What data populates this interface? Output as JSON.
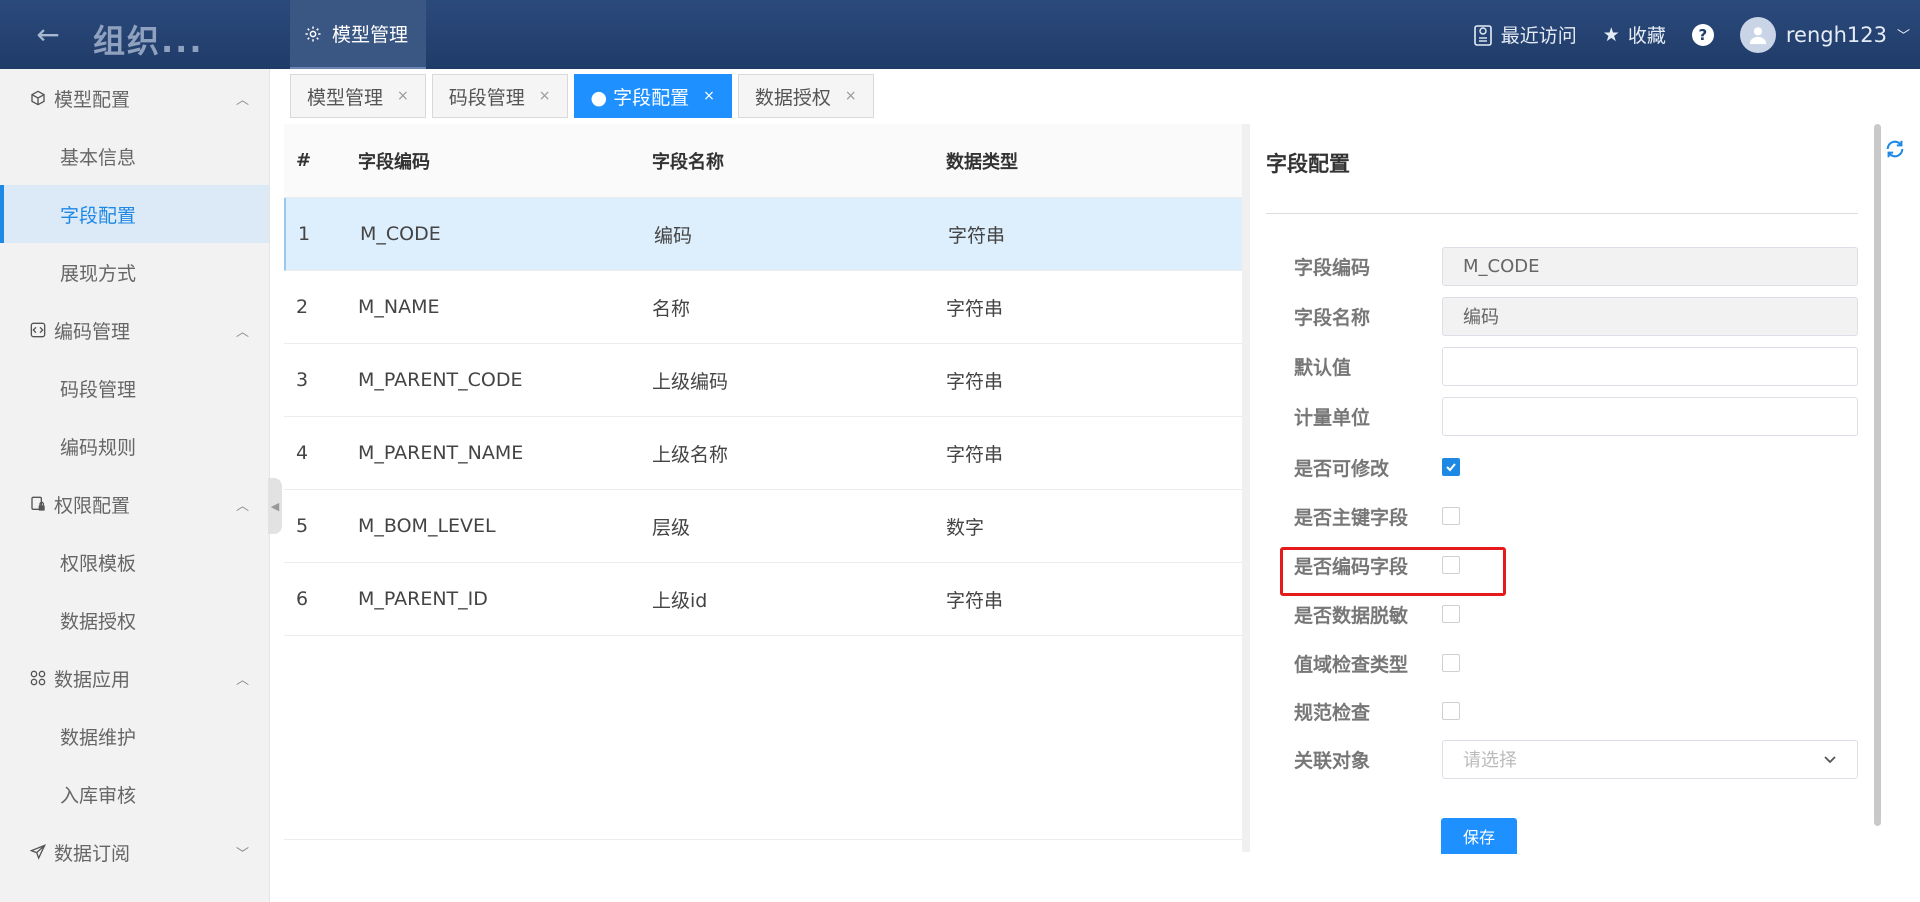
{
  "topbar": {
    "app_title": "组织...",
    "active_tab": "模型管理",
    "recent_visit": "最近访问",
    "favorites": "收藏",
    "help": "?",
    "username": "rengh123"
  },
  "sidebar": {
    "groups": [
      {
        "label": "模型配置",
        "icon": "cube-icon",
        "items": [
          "基本信息",
          "字段配置",
          "展现方式"
        ]
      },
      {
        "label": "编码管理",
        "icon": "code-icon",
        "items": [
          "码段管理",
          "编码规则"
        ]
      },
      {
        "label": "权限配置",
        "icon": "lock-doc-icon",
        "items": [
          "权限模板",
          "数据授权"
        ]
      },
      {
        "label": "数据应用",
        "icon": "grid-icon",
        "items": [
          "数据维护",
          "入库审核"
        ]
      },
      {
        "label": "数据订阅",
        "icon": "send-icon",
        "items": []
      }
    ],
    "active_item": "字段配置"
  },
  "tabs": [
    {
      "label": "模型管理",
      "close": "×"
    },
    {
      "label": "码段管理",
      "close": "×"
    },
    {
      "label": "● 字段配置",
      "close": "×"
    },
    {
      "label": "数据授权",
      "close": "×"
    }
  ],
  "table": {
    "headers": [
      "#",
      "字段编码",
      "字段名称",
      "数据类型"
    ],
    "rows": [
      [
        "1",
        "M_CODE",
        "编码",
        "字符串"
      ],
      [
        "2",
        "M_NAME",
        "名称",
        "字符串"
      ],
      [
        "3",
        "M_PARENT_CODE",
        "上级编码",
        "字符串"
      ],
      [
        "4",
        "M_PARENT_NAME",
        "上级名称",
        "字符串"
      ],
      [
        "5",
        "M_BOM_LEVEL",
        "层级",
        "数字"
      ],
      [
        "6",
        "M_PARENT_ID",
        "上级id",
        "字符串"
      ]
    ]
  },
  "panel": {
    "title": "字段配置",
    "fields": {
      "code_label": "字段编码",
      "code_value": "M_CODE",
      "name_label": "字段名称",
      "name_value": "编码",
      "default_label": "默认值",
      "default_value": "",
      "unit_label": "计量单位",
      "unit_value": "",
      "editable_label": "是否可修改",
      "editable_checked": true,
      "primary_label": "是否主键字段",
      "primary_checked": false,
      "encoding_label": "是否编码字段",
      "encoding_checked": false,
      "masking_label": "是否数据脱敏",
      "masking_checked": false,
      "domain_label": "值域检查类型",
      "domain_checked": false,
      "spec_label": "规范检查",
      "spec_checked": false,
      "relation_label": "关联对象",
      "relation_placeholder": "请选择"
    },
    "save_label": "保存"
  },
  "colors": {
    "header_bg": "#1f3b68",
    "accent": "#1e90ff",
    "highlight_box": "#e51b1b",
    "selected_row": "#ddeefc"
  }
}
